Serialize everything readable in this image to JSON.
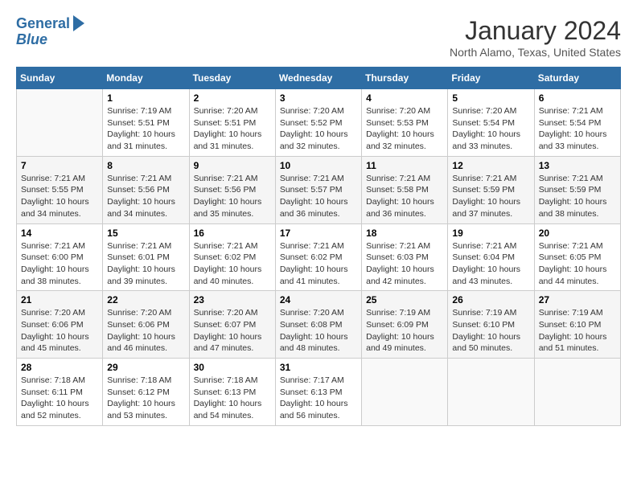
{
  "header": {
    "logo_line1": "General",
    "logo_line2": "Blue",
    "month_title": "January 2024",
    "location": "North Alamo, Texas, United States"
  },
  "days_of_week": [
    "Sunday",
    "Monday",
    "Tuesday",
    "Wednesday",
    "Thursday",
    "Friday",
    "Saturday"
  ],
  "weeks": [
    [
      {
        "day": "",
        "info": ""
      },
      {
        "day": "1",
        "info": "Sunrise: 7:19 AM\nSunset: 5:51 PM\nDaylight: 10 hours\nand 31 minutes."
      },
      {
        "day": "2",
        "info": "Sunrise: 7:20 AM\nSunset: 5:51 PM\nDaylight: 10 hours\nand 31 minutes."
      },
      {
        "day": "3",
        "info": "Sunrise: 7:20 AM\nSunset: 5:52 PM\nDaylight: 10 hours\nand 32 minutes."
      },
      {
        "day": "4",
        "info": "Sunrise: 7:20 AM\nSunset: 5:53 PM\nDaylight: 10 hours\nand 32 minutes."
      },
      {
        "day": "5",
        "info": "Sunrise: 7:20 AM\nSunset: 5:54 PM\nDaylight: 10 hours\nand 33 minutes."
      },
      {
        "day": "6",
        "info": "Sunrise: 7:21 AM\nSunset: 5:54 PM\nDaylight: 10 hours\nand 33 minutes."
      }
    ],
    [
      {
        "day": "7",
        "info": "Sunrise: 7:21 AM\nSunset: 5:55 PM\nDaylight: 10 hours\nand 34 minutes."
      },
      {
        "day": "8",
        "info": "Sunrise: 7:21 AM\nSunset: 5:56 PM\nDaylight: 10 hours\nand 34 minutes."
      },
      {
        "day": "9",
        "info": "Sunrise: 7:21 AM\nSunset: 5:56 PM\nDaylight: 10 hours\nand 35 minutes."
      },
      {
        "day": "10",
        "info": "Sunrise: 7:21 AM\nSunset: 5:57 PM\nDaylight: 10 hours\nand 36 minutes."
      },
      {
        "day": "11",
        "info": "Sunrise: 7:21 AM\nSunset: 5:58 PM\nDaylight: 10 hours\nand 36 minutes."
      },
      {
        "day": "12",
        "info": "Sunrise: 7:21 AM\nSunset: 5:59 PM\nDaylight: 10 hours\nand 37 minutes."
      },
      {
        "day": "13",
        "info": "Sunrise: 7:21 AM\nSunset: 5:59 PM\nDaylight: 10 hours\nand 38 minutes."
      }
    ],
    [
      {
        "day": "14",
        "info": "Sunrise: 7:21 AM\nSunset: 6:00 PM\nDaylight: 10 hours\nand 38 minutes."
      },
      {
        "day": "15",
        "info": "Sunrise: 7:21 AM\nSunset: 6:01 PM\nDaylight: 10 hours\nand 39 minutes."
      },
      {
        "day": "16",
        "info": "Sunrise: 7:21 AM\nSunset: 6:02 PM\nDaylight: 10 hours\nand 40 minutes."
      },
      {
        "day": "17",
        "info": "Sunrise: 7:21 AM\nSunset: 6:02 PM\nDaylight: 10 hours\nand 41 minutes."
      },
      {
        "day": "18",
        "info": "Sunrise: 7:21 AM\nSunset: 6:03 PM\nDaylight: 10 hours\nand 42 minutes."
      },
      {
        "day": "19",
        "info": "Sunrise: 7:21 AM\nSunset: 6:04 PM\nDaylight: 10 hours\nand 43 minutes."
      },
      {
        "day": "20",
        "info": "Sunrise: 7:21 AM\nSunset: 6:05 PM\nDaylight: 10 hours\nand 44 minutes."
      }
    ],
    [
      {
        "day": "21",
        "info": "Sunrise: 7:20 AM\nSunset: 6:06 PM\nDaylight: 10 hours\nand 45 minutes."
      },
      {
        "day": "22",
        "info": "Sunrise: 7:20 AM\nSunset: 6:06 PM\nDaylight: 10 hours\nand 46 minutes."
      },
      {
        "day": "23",
        "info": "Sunrise: 7:20 AM\nSunset: 6:07 PM\nDaylight: 10 hours\nand 47 minutes."
      },
      {
        "day": "24",
        "info": "Sunrise: 7:20 AM\nSunset: 6:08 PM\nDaylight: 10 hours\nand 48 minutes."
      },
      {
        "day": "25",
        "info": "Sunrise: 7:19 AM\nSunset: 6:09 PM\nDaylight: 10 hours\nand 49 minutes."
      },
      {
        "day": "26",
        "info": "Sunrise: 7:19 AM\nSunset: 6:10 PM\nDaylight: 10 hours\nand 50 minutes."
      },
      {
        "day": "27",
        "info": "Sunrise: 7:19 AM\nSunset: 6:10 PM\nDaylight: 10 hours\nand 51 minutes."
      }
    ],
    [
      {
        "day": "28",
        "info": "Sunrise: 7:18 AM\nSunset: 6:11 PM\nDaylight: 10 hours\nand 52 minutes."
      },
      {
        "day": "29",
        "info": "Sunrise: 7:18 AM\nSunset: 6:12 PM\nDaylight: 10 hours\nand 53 minutes."
      },
      {
        "day": "30",
        "info": "Sunrise: 7:18 AM\nSunset: 6:13 PM\nDaylight: 10 hours\nand 54 minutes."
      },
      {
        "day": "31",
        "info": "Sunrise: 7:17 AM\nSunset: 6:13 PM\nDaylight: 10 hours\nand 56 minutes."
      },
      {
        "day": "",
        "info": ""
      },
      {
        "day": "",
        "info": ""
      },
      {
        "day": "",
        "info": ""
      }
    ]
  ]
}
